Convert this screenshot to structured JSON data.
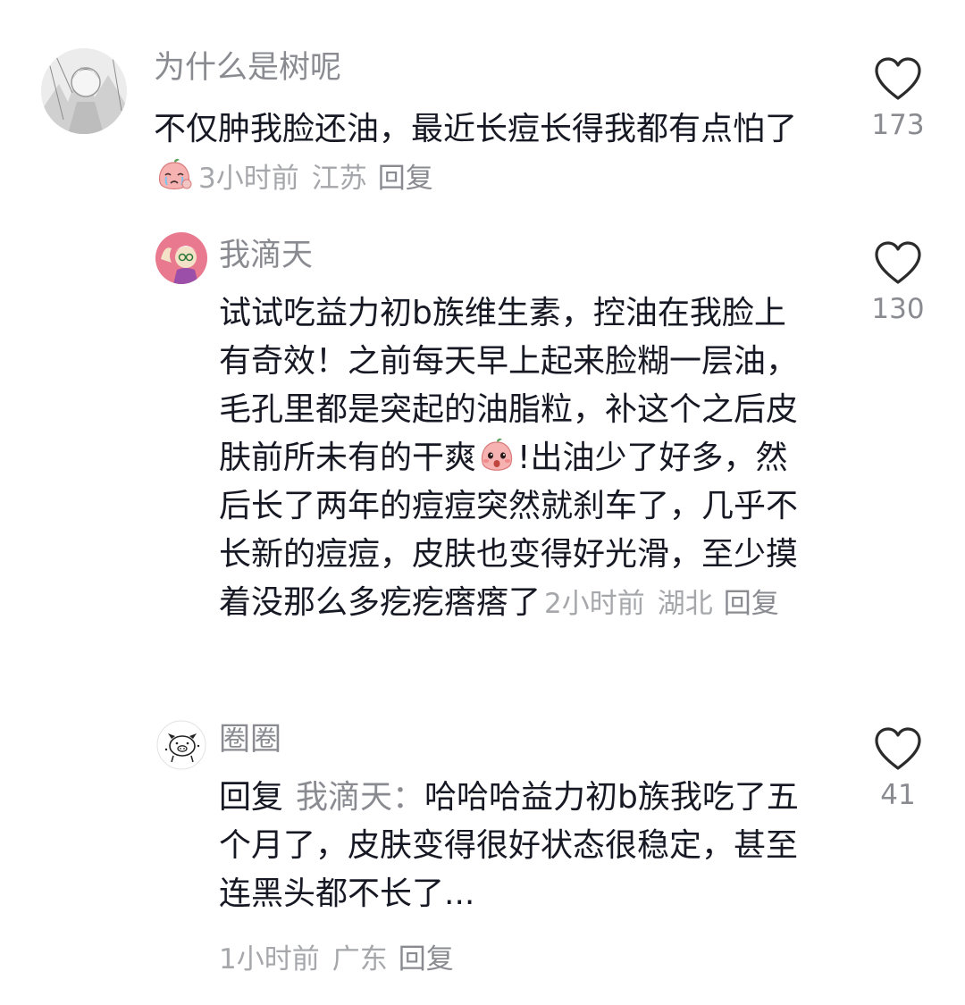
{
  "comments": [
    {
      "username": "为什么是树呢",
      "text_before_emoji": "不仅肿我脸还油，最近长痘长得我都有点怕了",
      "emoji_icon": "crying-peach-emoji",
      "time": "3小时前",
      "region": "江苏",
      "reply_label": "回复",
      "like_count": "173"
    },
    {
      "username": "我滴天",
      "text_before_emoji": "试试吃益力初b族维生素，控油在我脸上有奇效！之前每天早上起来脸糊一层油，毛孔里都是突起的油脂粒，补这个之后皮肤前所未有的干爽",
      "emoji_icon": "surprised-peach-emoji",
      "text_after_emoji": "!出油少了好多，然后长了两年的痘痘突然就刹车了，几乎不长新的痘痘，皮肤也变得好光滑，至少摸着没那么多疙疙瘩瘩了",
      "time": "2小时前",
      "region": "湖北",
      "reply_label": "回复",
      "like_count": "130"
    },
    {
      "username": "圈圈",
      "reply_prefix": "回复",
      "reply_target": "我滴天：",
      "text": "哈哈哈益力初b族我吃了五个月了，皮肤变得很好状态很稳定，甚至连黑头都不长了...",
      "time": "1小时前",
      "region": "广东",
      "reply_label": "回复",
      "like_count": "41"
    }
  ],
  "colors": {
    "primary_text": "#161823",
    "secondary_text": "#8a8b91",
    "meta_text": "#a6a7ab",
    "heart_stroke": "#2b2b2b"
  },
  "icons": {
    "like": "heart-outline-icon"
  }
}
